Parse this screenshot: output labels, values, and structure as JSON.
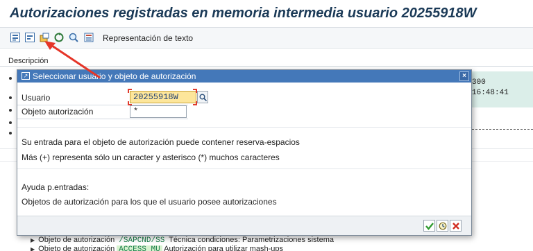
{
  "title": "Autorizaciones registradas en memoria intermedia usuario 20255918W",
  "toolbar": {
    "icons": [
      "expand-all-icon",
      "collapse-all-icon",
      "find-icon",
      "refresh-icon",
      "zoom-icon",
      "settings-icon"
    ],
    "text_button": "Representación de texto"
  },
  "main": {
    "description_label": "Descripción",
    "right_values": [
      "300",
      "16:48:41"
    ],
    "bottom_rows": [
      {
        "prefix": "Objeto de autorización",
        "code": "/SAPCND/SS",
        "description": "Técnica condiciones: Parametrizaciones sistema"
      },
      {
        "prefix": "Objeto de autorización",
        "code": "ACCESS_MU",
        "description": "Autorización para utilizar mash-ups"
      }
    ]
  },
  "dialog": {
    "title": "Seleccionar usuario y objeto de autorización",
    "user_label": "Usuario",
    "user_value": "20255918W",
    "object_label": "Objeto autorización",
    "object_value": "*",
    "info_line_1": "Su entrada para el objeto de autorización puede contener reserva-espacios",
    "info_line_2": "Más (+) representa sólo un caracter y asterisco (*) muchos caracteres",
    "help_heading": "Ayuda p.entradas:",
    "help_text": "Objetos de autorización para los que el usuario posee autorizaciones",
    "footer_buttons": [
      "confirm",
      "execute",
      "cancel"
    ]
  },
  "colors": {
    "title_text": "#1b3a57",
    "dialog_header": "#4478b9",
    "user_field_bg": "#fde69b",
    "annotation_arrow": "#e53528"
  }
}
